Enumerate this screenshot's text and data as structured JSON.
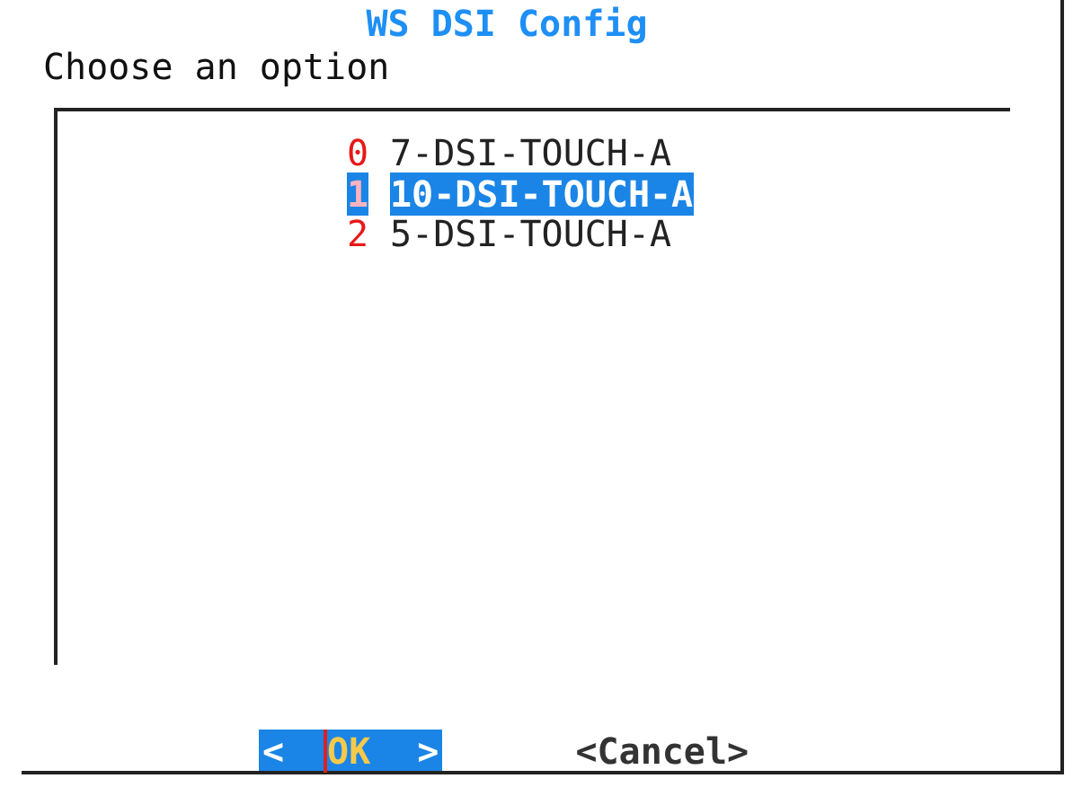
{
  "dialog": {
    "title": "WS DSI Config",
    "prompt": "Choose an option"
  },
  "items": [
    {
      "tag": "0",
      "label": "7-DSI-TOUCH-A",
      "selected": false
    },
    {
      "tag": "1",
      "label": "10-DSI-TOUCH-A",
      "selected": true
    },
    {
      "tag": "2",
      "label": "5-DSI-TOUCH-A",
      "selected": false
    }
  ],
  "buttons": [
    {
      "open": "<",
      "label": "OK",
      "close": ">",
      "selected": true
    },
    {
      "open": "<",
      "label": "Cancel",
      "close": ">",
      "selected": false
    }
  ]
}
